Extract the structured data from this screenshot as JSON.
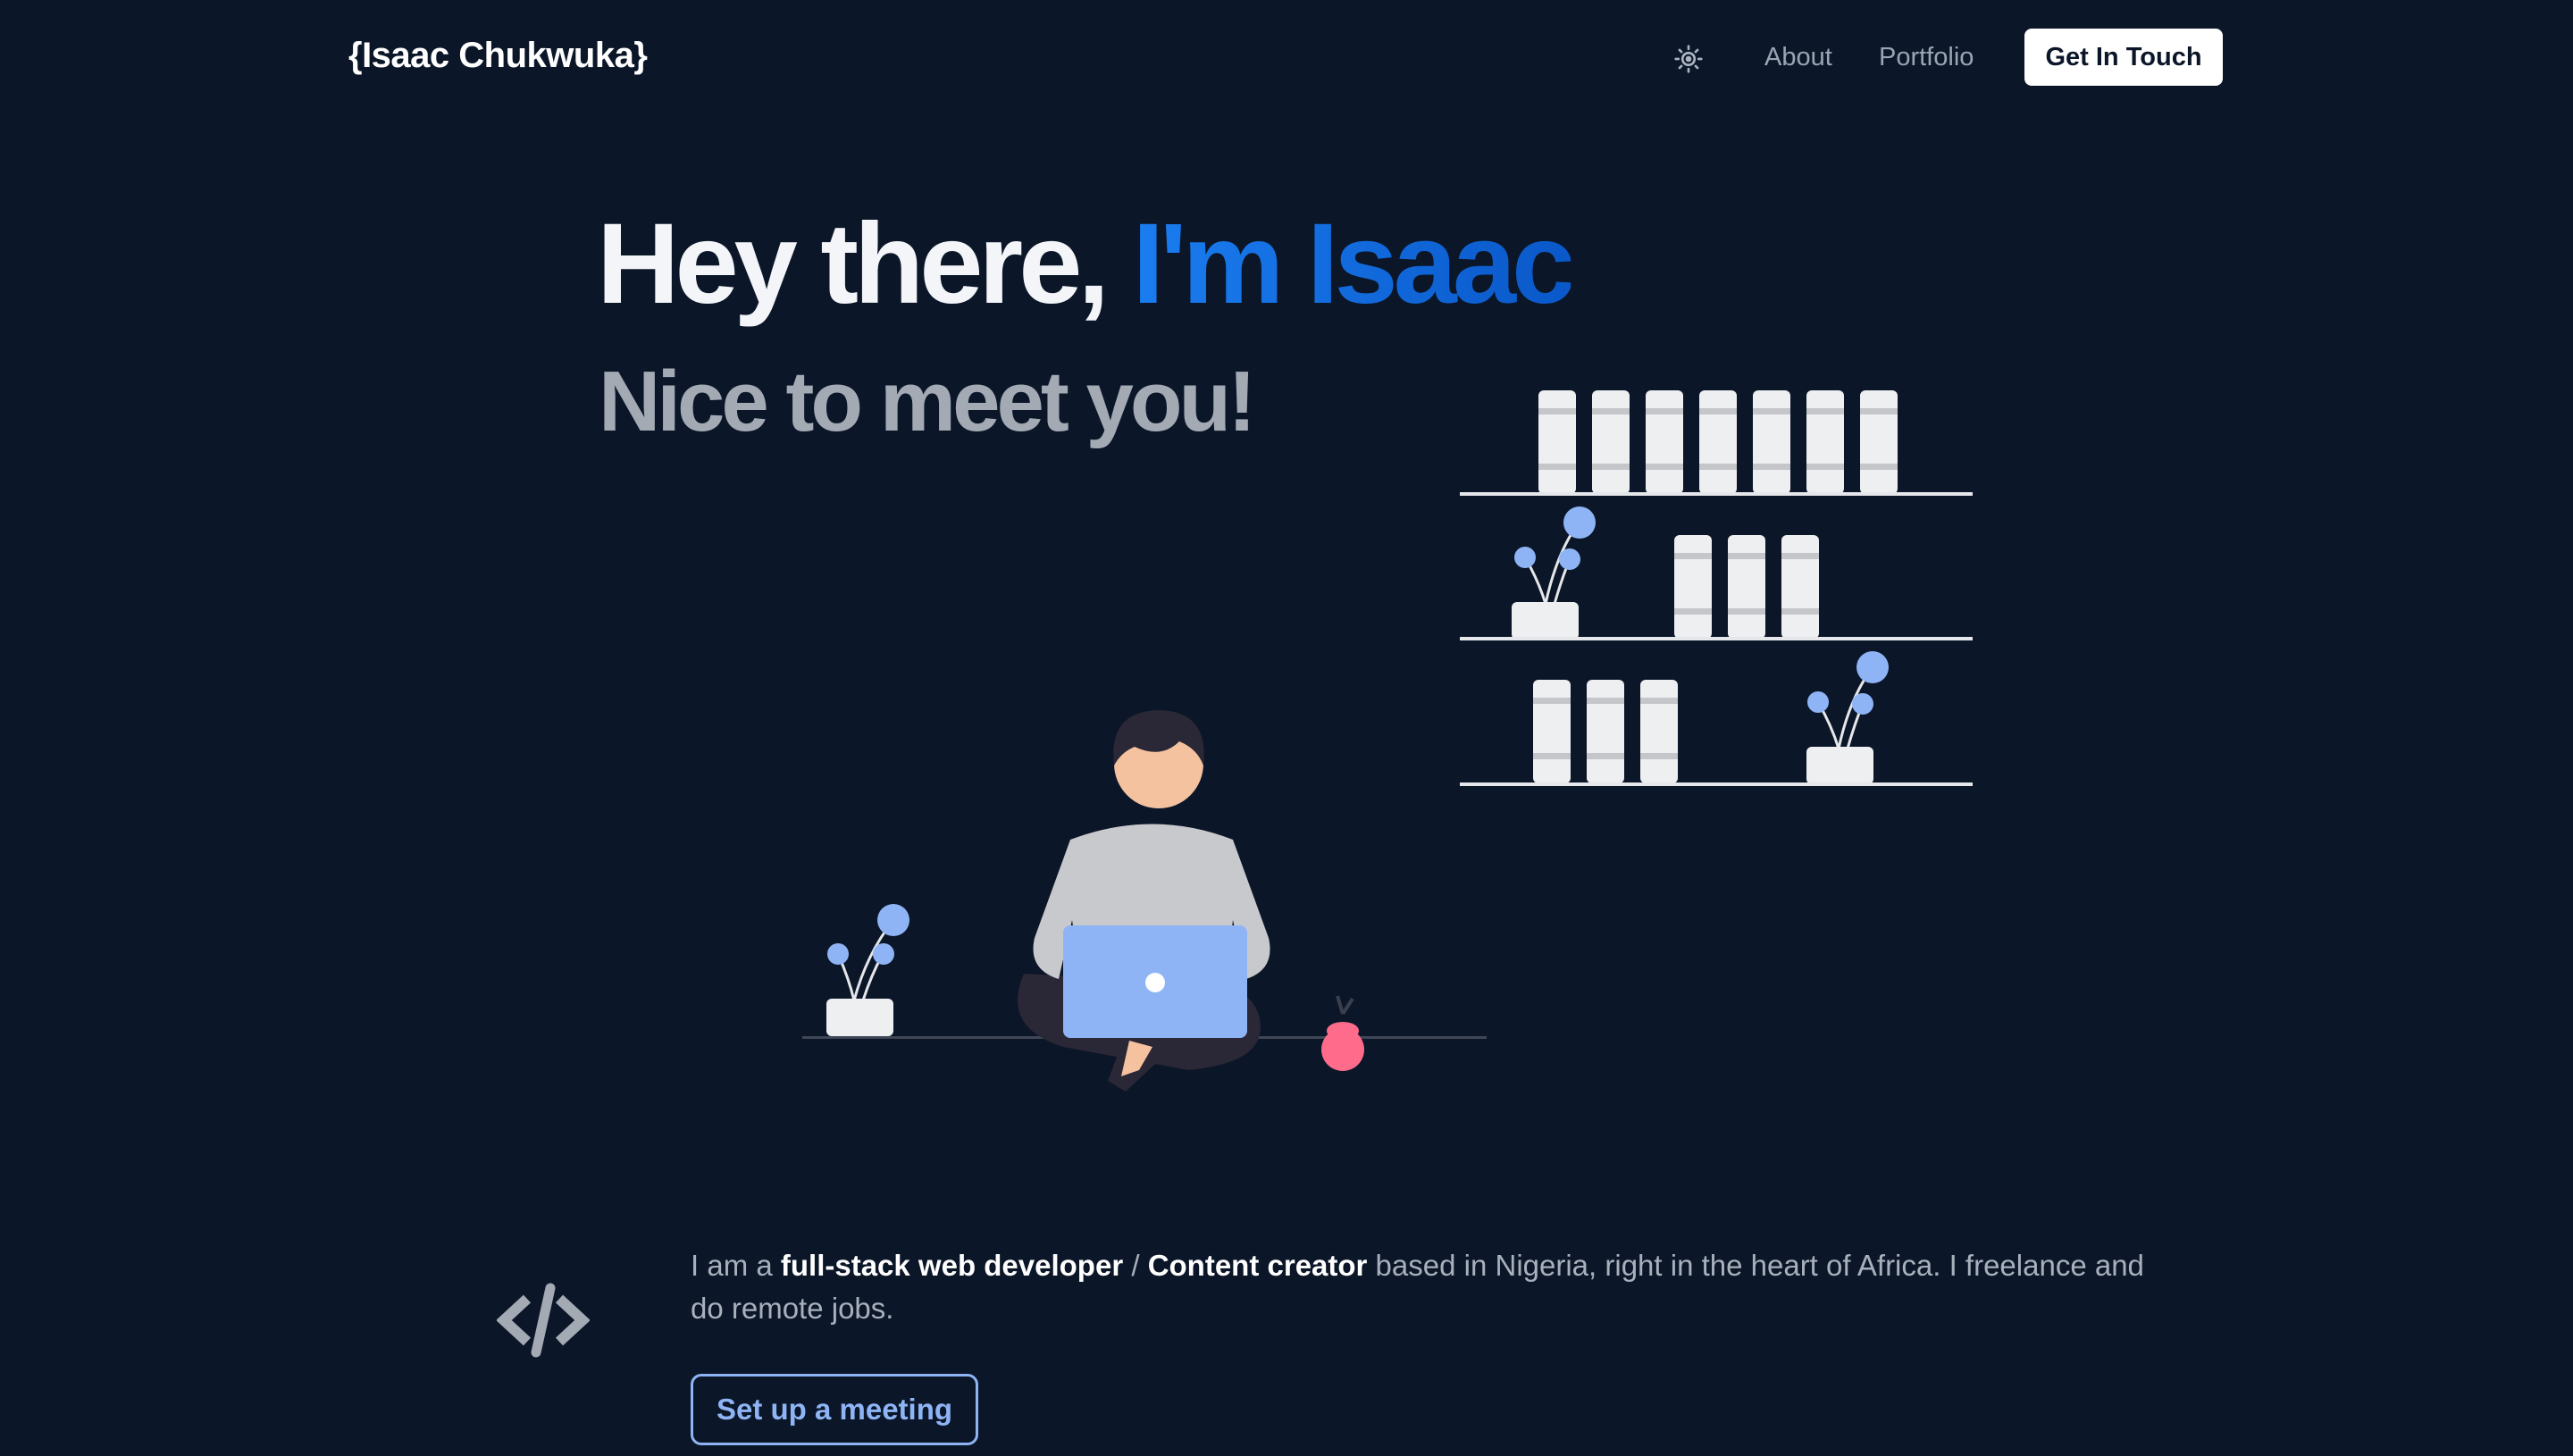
{
  "nav": {
    "logo": "{Isaac Chukwuka}",
    "theme_icon": "sun-icon",
    "links": [
      "About",
      "Portfolio"
    ],
    "cta_label": "Get In Touch"
  },
  "hero": {
    "greeting": "Hey there, ",
    "name": "I'm Isaac",
    "subtitle": "Nice to meet you!"
  },
  "intro": {
    "icon": "code-icon",
    "prefix": "I am a ",
    "role1": "full-stack web developer",
    "separator": " / ",
    "role2": "Content creator",
    "suffix": " based in Nigeria, right in the heart of Africa. I freelance and do remote jobs.",
    "button_label": "Set up a meeting"
  },
  "colors": {
    "background": "#0b1628",
    "accent": "#1a7df0",
    "button_outline": "#8fb4f5",
    "plant_blue": "#8fb4f5"
  }
}
